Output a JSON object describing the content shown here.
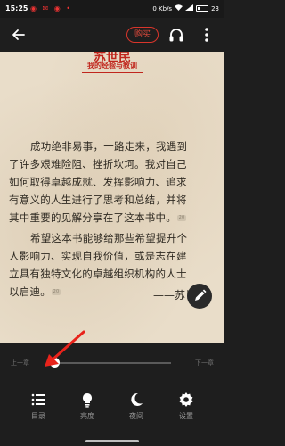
{
  "status_bar": {
    "time": "15:25",
    "app_icons": "◉ ✉ ◉ •",
    "signal_text": "0 Kb/s",
    "battery_level": "23"
  },
  "top_bar": {
    "buy_label": "购买"
  },
  "page": {
    "chapter_title_line1": "苏世民",
    "chapter_title_line2": "我的经验与教训",
    "paragraph1": [
      "成功绝非易事，一路走来，我遇到",
      "了许多艰难险阻、挫折坎坷。我对自己",
      "如何取得卓越成就、发挥影响力、追求",
      "有意义的人生进行了思考和总结，并将",
      "其中重要的见解分享在了这本书中。"
    ],
    "paragraph2": [
      "希望这本书能够给那些希望提升个",
      "人影响力、实现自我价值，或是志在建",
      "立具有独特文化的卓越组织机构的人士",
      "以启迪。"
    ],
    "comment_badge_1": "20",
    "comment_badge_2": "20",
    "signature": "——苏世"
  },
  "reader_controls": {
    "prev_chapter_label": "上一章",
    "next_chapter_label": "下一章",
    "progress_fraction": 0.0
  },
  "bottom_menu": {
    "catalog_label": "目录",
    "brightness_label": "亮度",
    "night_label": "夜间",
    "settings_label": "设置"
  },
  "colors": {
    "page_background": "#e9ddc9",
    "accent_red": "#c0261d",
    "toolbar_background": "#1e1e1e",
    "annotation_arrow": "#e8231b"
  }
}
